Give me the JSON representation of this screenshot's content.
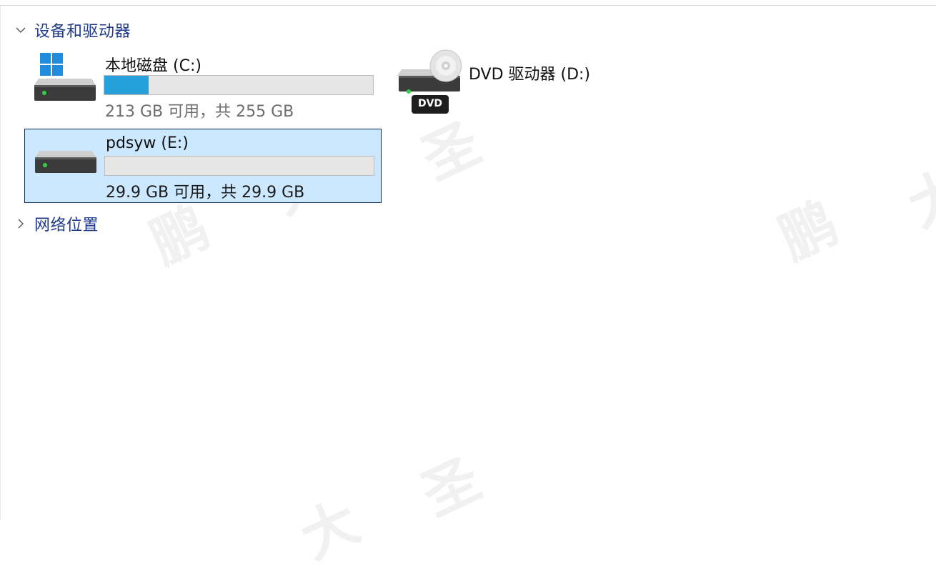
{
  "sections": {
    "devices": {
      "label": "设备和驱动器",
      "expanded": true
    },
    "network": {
      "label": "网络位置",
      "expanded": false
    }
  },
  "drives": [
    {
      "name": "本地磁盘 (C:)",
      "info": "213 GB 可用，共 255 GB",
      "used_fraction": 0.165,
      "selected": false,
      "icon": "windows-hdd-icon"
    },
    {
      "name": "DVD 驱动器 (D:)",
      "badge": "DVD",
      "icon": "dvd-drive-icon"
    },
    {
      "name": "pdsyw (E:)",
      "info": "29.9 GB 可用，共 29.9 GB",
      "used_fraction": 0.0,
      "selected": true,
      "icon": "hdd-icon"
    }
  ],
  "watermark": {
    "chars": [
      "鹏",
      "大",
      "圣"
    ]
  },
  "colors": {
    "accent": "#26a0da",
    "selection_bg": "#cce8ff",
    "section_title": "#1f3a8a"
  }
}
